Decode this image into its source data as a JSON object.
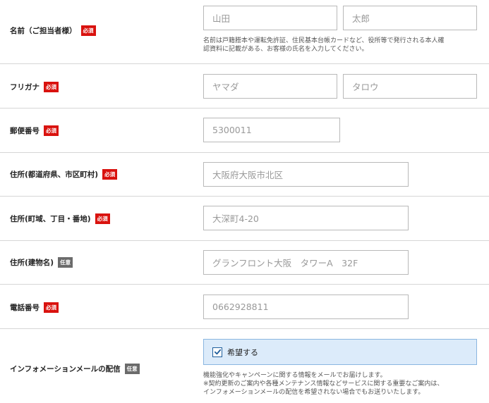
{
  "rows": {
    "name": {
      "label": "名前（ご担当者様）",
      "badge": "必須",
      "last_placeholder": "山田",
      "first_placeholder": "太郎",
      "note_line1": "名前は戸籍謄本や運転免許証、住民基本台帳カードなど、役所等で発行される本人確",
      "note_line2": "認資料に記載がある、お客様の氏名を入力してください。"
    },
    "furigana": {
      "label": "フリガナ",
      "badge": "必須",
      "last_placeholder": "ヤマダ",
      "first_placeholder": "タロウ"
    },
    "postal": {
      "label": "郵便番号",
      "badge": "必須",
      "placeholder": "5300011"
    },
    "address1": {
      "label": "住所(都道府県、市区町村)",
      "badge": "必須",
      "placeholder": "大阪府大阪市北区"
    },
    "address2": {
      "label": "住所(町域、丁目・番地)",
      "badge": "必須",
      "placeholder": "大深町4-20"
    },
    "address3": {
      "label": "住所(建物名)",
      "badge": "任意",
      "placeholder": "グランフロント大阪　タワーA　32F"
    },
    "phone": {
      "label": "電話番号",
      "badge": "必須",
      "placeholder": "0662928811"
    },
    "newsletter": {
      "label": "インフォメーションメールの配信",
      "badge": "任意",
      "checkbox_label": "希望する",
      "checked": true,
      "note_line1": "機能強化やキャンペーンに関する情報をメールでお届けします。",
      "note_line2": "※契約更新のご案内や各種メンテナンス情報などサービスに関する重要なご案内は、",
      "note_line3": "インフォメーションメールの配信を希望されない場合でもお送りいたします。"
    }
  },
  "colors": {
    "required_badge": "#d9120e",
    "optional_badge": "#6b6b6b",
    "checkbox_bg": "#dcebfa",
    "checkbox_border": "#8ab6e0"
  }
}
